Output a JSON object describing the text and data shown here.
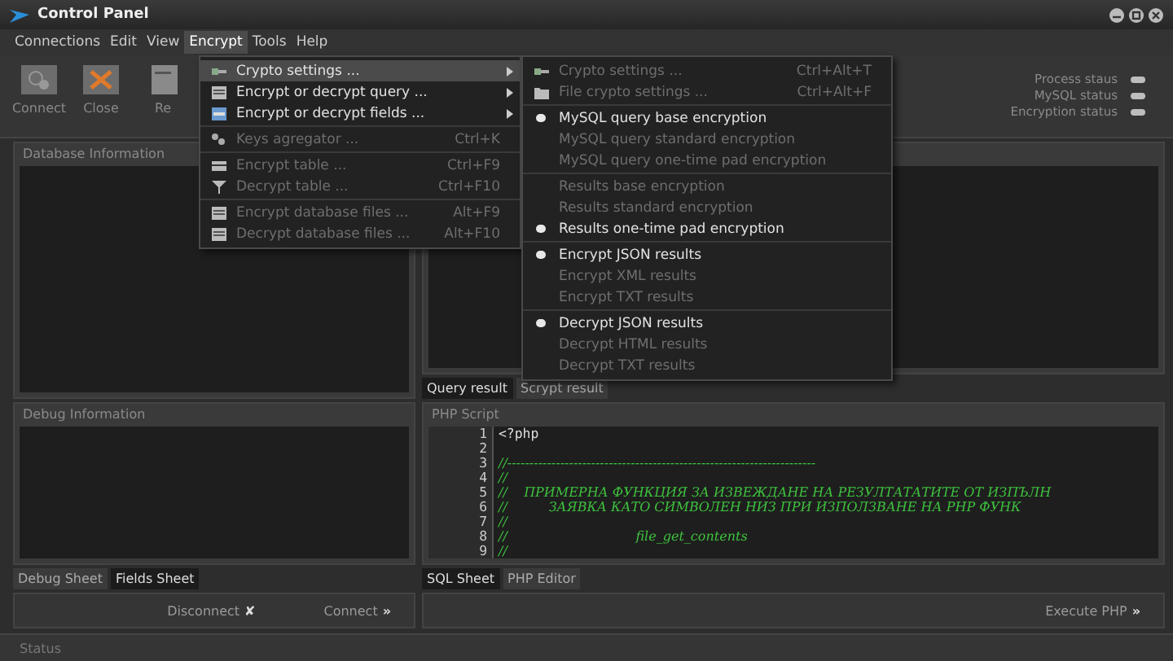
{
  "window": {
    "title": "Control Panel"
  },
  "menubar": [
    {
      "label": "Connections",
      "selected": false
    },
    {
      "label": "Edit",
      "selected": false
    },
    {
      "label": "View",
      "selected": false
    },
    {
      "label": "Encrypt",
      "selected": true
    },
    {
      "label": "Tools",
      "selected": false
    },
    {
      "label": "Help",
      "selected": false
    }
  ],
  "toolbar": [
    {
      "label": "Connect",
      "kind": "plug"
    },
    {
      "label": "Close",
      "kind": "close"
    },
    {
      "label": "Re",
      "kind": "doc"
    }
  ],
  "status_indicators": [
    "Process staus",
    "MySQL status",
    "Encryption status"
  ],
  "encrypt_menu": {
    "groups": [
      {
        "items": [
          {
            "label": "Crypto settings ...",
            "submenu": true,
            "disabled": false,
            "selected": true
          },
          {
            "label": "Encrypt or decrypt query ...",
            "submenu": true,
            "disabled": false,
            "selected": false
          },
          {
            "label": "Encrypt or decrypt fields ...",
            "submenu": true,
            "disabled": false,
            "selected": false
          }
        ]
      },
      {
        "items": [
          {
            "label": "Keys agregator ...",
            "submenu": false,
            "shortcut": "Ctrl+K",
            "disabled": true,
            "selected": false
          }
        ]
      },
      {
        "items": [
          {
            "label": "Encrypt table ...",
            "submenu": false,
            "shortcut": "Ctrl+F9",
            "disabled": true,
            "selected": false
          },
          {
            "label": "Decrypt table ...",
            "submenu": false,
            "shortcut": "Ctrl+F10",
            "disabled": true,
            "selected": false
          }
        ]
      },
      {
        "items": [
          {
            "label": "Encrypt database files ...",
            "submenu": false,
            "shortcut": "Alt+F9",
            "disabled": true,
            "selected": false
          },
          {
            "label": "Decrypt database files ...",
            "submenu": false,
            "shortcut": "Alt+F10",
            "disabled": true,
            "selected": false
          }
        ]
      }
    ]
  },
  "crypto_submenu": {
    "groups": [
      {
        "items": [
          {
            "label": "Crypto settings ...",
            "shortcut": "Ctrl+Alt+T",
            "disabled": true
          },
          {
            "label": "File crypto settings ...",
            "shortcut": "Ctrl+Alt+F",
            "disabled": true
          }
        ]
      },
      {
        "items": [
          {
            "label": "MySQL query base encryption",
            "disabled": false,
            "checked": true
          },
          {
            "label": "MySQL query standard encryption",
            "disabled": true,
            "checked": false
          },
          {
            "label": "MySQL query one-time pad encryption",
            "disabled": true,
            "checked": false
          }
        ]
      },
      {
        "items": [
          {
            "label": "Results base encryption",
            "disabled": true,
            "checked": false
          },
          {
            "label": "Results standard encryption",
            "disabled": true,
            "checked": false
          },
          {
            "label": "Results one-time pad encryption",
            "disabled": false,
            "checked": true
          }
        ]
      },
      {
        "items": [
          {
            "label": "Encrypt JSON results",
            "disabled": false,
            "checked": true
          },
          {
            "label": "Encrypt XML results",
            "disabled": true,
            "checked": false
          },
          {
            "label": "Encrypt TXT results",
            "disabled": true,
            "checked": false
          }
        ]
      },
      {
        "items": [
          {
            "label": "Decrypt JSON results",
            "disabled": false,
            "checked": true
          },
          {
            "label": "Decrypt HTML results",
            "disabled": true,
            "checked": false
          },
          {
            "label": "Decrypt TXT results",
            "disabled": true,
            "checked": false
          }
        ]
      }
    ]
  },
  "database_panel": {
    "title": "Database Information"
  },
  "result_tabs": [
    {
      "label": "Query result",
      "selected": true
    },
    {
      "label": "Scrypt result",
      "selected": false
    }
  ],
  "debug_panel": {
    "title": "Debug Information"
  },
  "debug_tabs": [
    {
      "label": "Debug Sheet",
      "selected": false
    },
    {
      "label": "Fields Sheet",
      "selected": true
    }
  ],
  "left_actions": [
    {
      "label": "Disconnect",
      "icon": "✘"
    },
    {
      "label": "Connect",
      "icon": "»"
    }
  ],
  "php_panel": {
    "title": "PHP Script",
    "lines": [
      {
        "number": "1",
        "kind": "code",
        "text": "<?php"
      },
      {
        "number": "2",
        "kind": "code"
      },
      {
        "number": "3",
        "kind": "comment",
        "text": "//----------------------------------------------------------------------"
      },
      {
        "number": "4",
        "kind": "comment",
        "text": "//"
      },
      {
        "number": "5",
        "kind": "comment",
        "text": "//    ПРИМЕРНА ФУНКЦИЯ ЗА ИЗВЕЖДАНЕ НА РЕЗУЛТАТАТИТЕ ОТ ИЗПЪЛН"
      },
      {
        "number": "6",
        "kind": "comment",
        "text": "//          ЗАЯВКА КАТО СИМВОЛЕН НИЗ ПРИ ИЗПОЛЗВАНЕ НА PHP ФУНК"
      },
      {
        "number": "7",
        "kind": "comment",
        "text": "//"
      },
      {
        "number": "8",
        "kind": "comment",
        "text": "//                               file_get_contents"
      },
      {
        "number": "9",
        "kind": "comment",
        "text": "//"
      }
    ]
  },
  "php_tabs": [
    {
      "label": "SQL Sheet",
      "selected": true
    },
    {
      "label": "PHP Editor",
      "selected": false
    }
  ],
  "right_actions": [
    {
      "label": "Execute PHP",
      "icon": "»"
    }
  ],
  "status_bar": {
    "label": "Status"
  }
}
